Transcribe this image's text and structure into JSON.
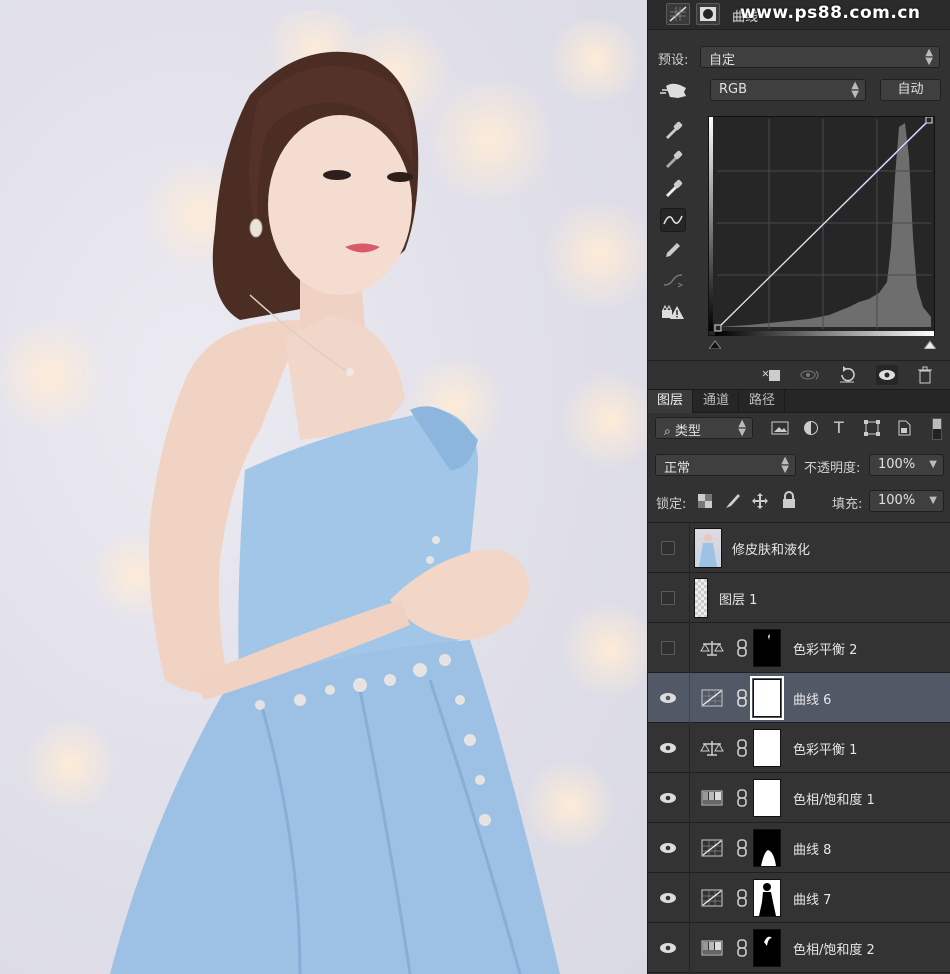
{
  "watermark": "www.ps88.com.cn",
  "properties": {
    "title": "曲线",
    "preset_label": "预设:",
    "preset_value": "自定",
    "channel_value": "RGB",
    "auto_button": "自动"
  },
  "tabs": [
    "图层",
    "通道",
    "路径"
  ],
  "layers_toolbar": {
    "filter_kind": "类型",
    "blend_mode": "正常",
    "opacity_label": "不透明度:",
    "opacity_value": "100%",
    "lock_label": "锁定:",
    "fill_label": "填充:",
    "fill_value": "100%"
  },
  "layers": [
    {
      "name": "修皮肤和液化",
      "visible": false,
      "type": "smart",
      "selected": false
    },
    {
      "name": "图层 1",
      "visible": false,
      "type": "pixel",
      "selected": false
    },
    {
      "name": "色彩平衡 2",
      "visible": false,
      "type": "color-balance",
      "selected": false
    },
    {
      "name": "曲线 6",
      "visible": true,
      "type": "curves",
      "selected": true
    },
    {
      "name": "色彩平衡 1",
      "visible": true,
      "type": "color-balance",
      "selected": false
    },
    {
      "name": "色相/饱和度 1",
      "visible": true,
      "type": "hue-saturation",
      "selected": false
    },
    {
      "name": "曲线 8",
      "visible": true,
      "type": "curves",
      "selected": false
    },
    {
      "name": "曲线 7",
      "visible": true,
      "type": "curves",
      "selected": false
    },
    {
      "name": "色相/饱和度 2",
      "visible": true,
      "type": "hue-saturation",
      "selected": false
    }
  ],
  "colors": {
    "panel_bg": "#323232",
    "selected_row": "#515967",
    "dress_blue": "#9dc3e6"
  }
}
